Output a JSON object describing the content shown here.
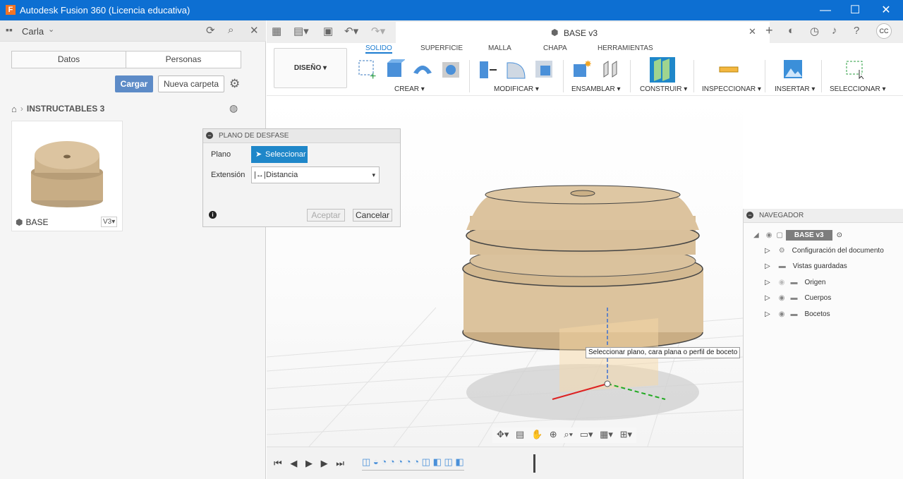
{
  "window": {
    "title": "Autodesk Fusion 360 (Licencia educativa)",
    "logo": "F"
  },
  "user": {
    "name": "Carla"
  },
  "data_panel": {
    "tabs": [
      "Datos",
      "Personas"
    ],
    "upload_label": "Cargar",
    "new_folder_label": "Nueva carpeta",
    "breadcrumb": "INSTRUCTABLES 3",
    "file": {
      "name": "BASE",
      "version": "V3"
    }
  },
  "doc_tab": {
    "title": "BASE v3"
  },
  "user_initials": "CC",
  "toolbar": {
    "workspace": "DISEÑO",
    "tabs": [
      "SOLIDO",
      "SUPERFICIE",
      "MALLA",
      "CHAPA",
      "HERRAMIENTAS"
    ],
    "active_tab": "SOLIDO",
    "groups": [
      "CREAR",
      "MODIFICAR",
      "ENSAMBLAR",
      "CONSTRUIR",
      "INSPECCIONAR",
      "INSERTAR",
      "SELECCIONAR"
    ]
  },
  "dialog": {
    "title": "PLANO DE DESFASE",
    "plane_label": "Plano",
    "select_label": "Seleccionar",
    "extension_label": "Extensión",
    "extension_value": "Distancia",
    "ok_label": "Aceptar",
    "cancel_label": "Cancelar"
  },
  "tooltip": "Seleccionar plano, cara plana o perfil de boceto",
  "navigator": {
    "title": "NAVEGADOR",
    "root": "BASE v3",
    "items": [
      "Configuración del documento",
      "Vistas guardadas",
      "Origen",
      "Cuerpos",
      "Bocetos"
    ]
  },
  "colors": {
    "titlebar": "#0d6fd2",
    "accent": "#1f87c9",
    "upload": "#5d8bc7",
    "body": "#d9c09a"
  }
}
